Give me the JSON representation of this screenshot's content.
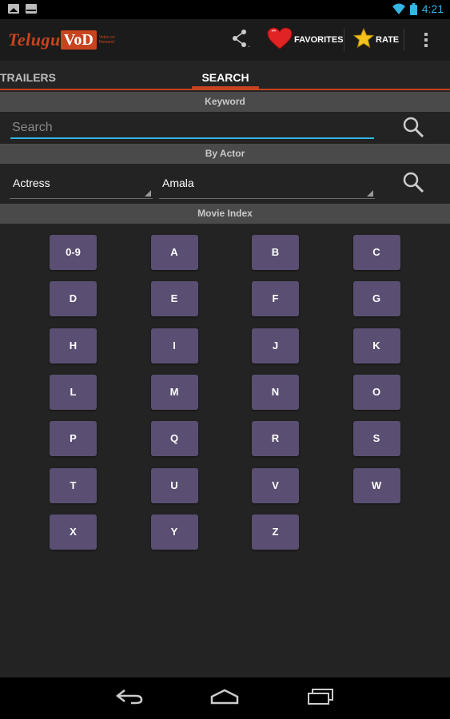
{
  "status_bar": {
    "time": "4:21",
    "icons": [
      "gallery-notification-icon",
      "mail-notification-icon",
      "wifi-icon",
      "battery-icon"
    ]
  },
  "app": {
    "logo_telugu": "Telugu",
    "logo_vod": "VoD",
    "logo_tagline": "Video on Demand"
  },
  "action_bar": {
    "favorites_label": "FAVORITES",
    "rate_label": "RATE"
  },
  "tabs": {
    "trailers": "TRAILERS",
    "search": "SEARCH"
  },
  "keyword": {
    "header": "Keyword",
    "placeholder": "Search"
  },
  "by_actor": {
    "header": "By Actor",
    "role_value": "Actress",
    "name_value": "Amala"
  },
  "movie_index": {
    "header": "Movie Index",
    "letters": [
      "0-9",
      "A",
      "B",
      "C",
      "D",
      "E",
      "F",
      "G",
      "H",
      "I",
      "J",
      "K",
      "L",
      "M",
      "N",
      "O",
      "P",
      "Q",
      "R",
      "S",
      "T",
      "U",
      "V",
      "W",
      "X",
      "Y",
      "Z"
    ]
  },
  "colors": {
    "accent": "#c8441f",
    "input_underline": "#33b5e5",
    "index_button": "#5a4f72",
    "section_header": "#4a4a4a"
  }
}
